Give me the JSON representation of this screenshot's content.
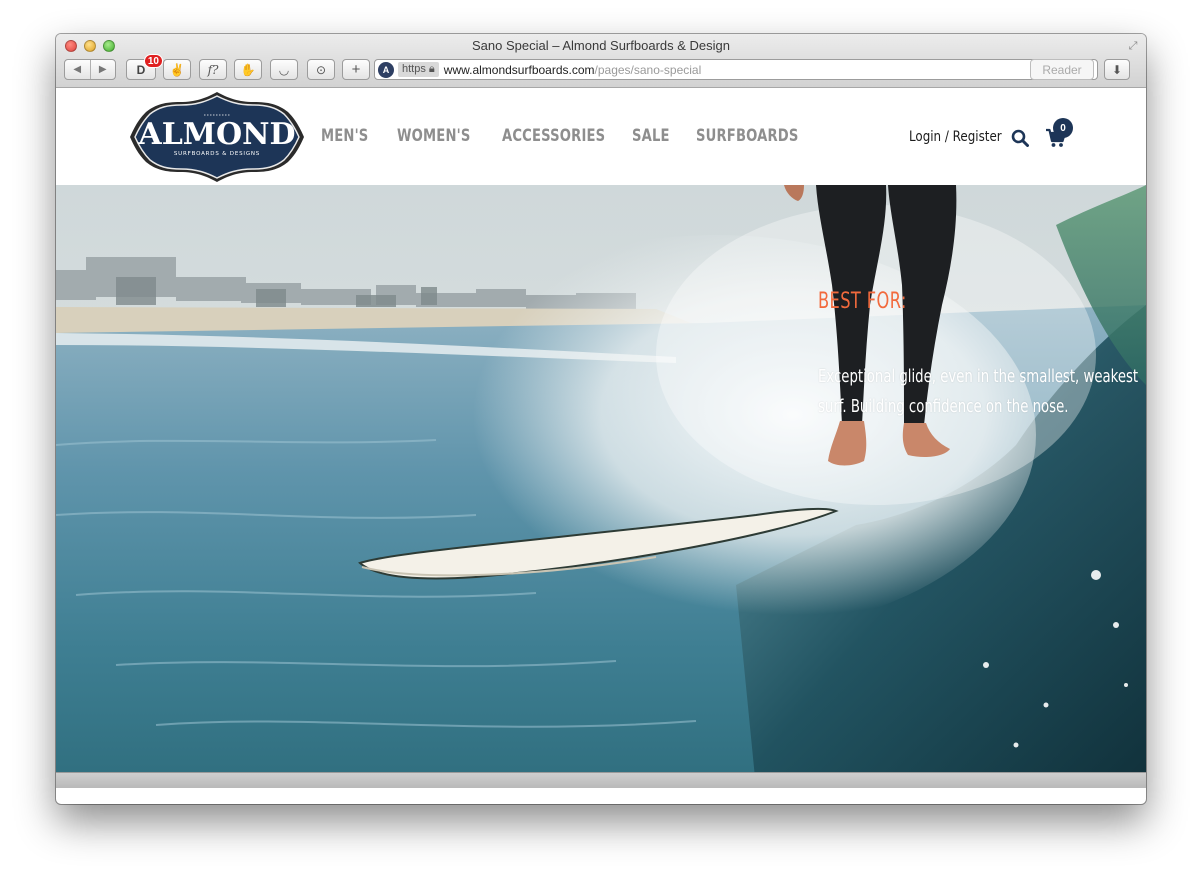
{
  "window": {
    "title": "Sano Special – Almond Surfboards & Design"
  },
  "toolbar": {
    "badge_count": "10",
    "reader_label": "Reader",
    "url": {
      "scheme_badge": "https",
      "host": "www.almondsurfboards.com",
      "path": "/pages/sano-special"
    }
  },
  "site": {
    "logo": {
      "brand": "ALMOND",
      "tagline": "SURFBOARDS & DESIGNS"
    },
    "nav": [
      {
        "label": "MEN'S"
      },
      {
        "label": "WOMEN'S"
      },
      {
        "label": "ACCESSORIES"
      },
      {
        "label": "SALE"
      },
      {
        "label": "SURFBOARDS"
      }
    ],
    "login_label": "Login / Register",
    "cart_count": "0",
    "colors": {
      "brand_navy": "#1d3557",
      "accent_orange": "#f26a3d",
      "nav_gray": "#8e8e8e"
    }
  },
  "hero": {
    "heading": "BEST FOR:",
    "description": "Exceptional glide, even in the smallest, weakest surf. Building confidence on the nose."
  }
}
